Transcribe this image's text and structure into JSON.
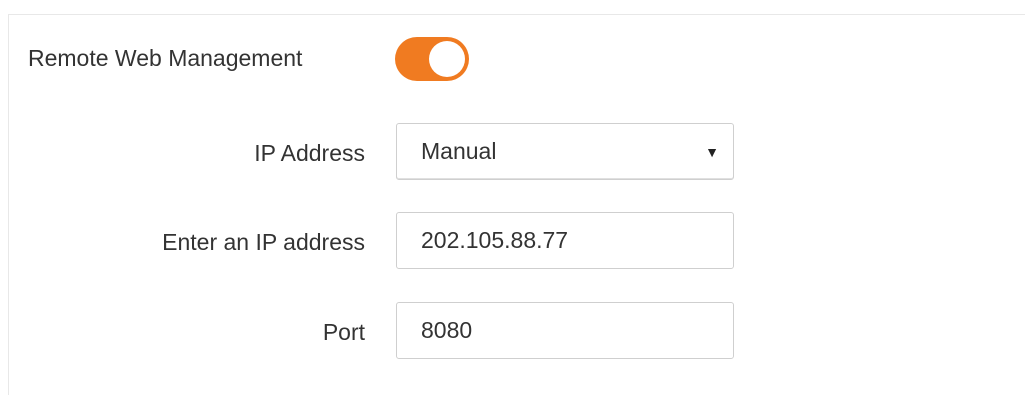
{
  "remote_management": {
    "label": "Remote Web Management",
    "enabled": true,
    "accent_color": "#f07b21"
  },
  "ip_address": {
    "label": "IP Address",
    "selected": "Manual",
    "caret": "▼"
  },
  "enter_ip": {
    "label": "Enter an IP address",
    "value": "202.105.88.77"
  },
  "port": {
    "label": "Port",
    "value": "8080"
  }
}
